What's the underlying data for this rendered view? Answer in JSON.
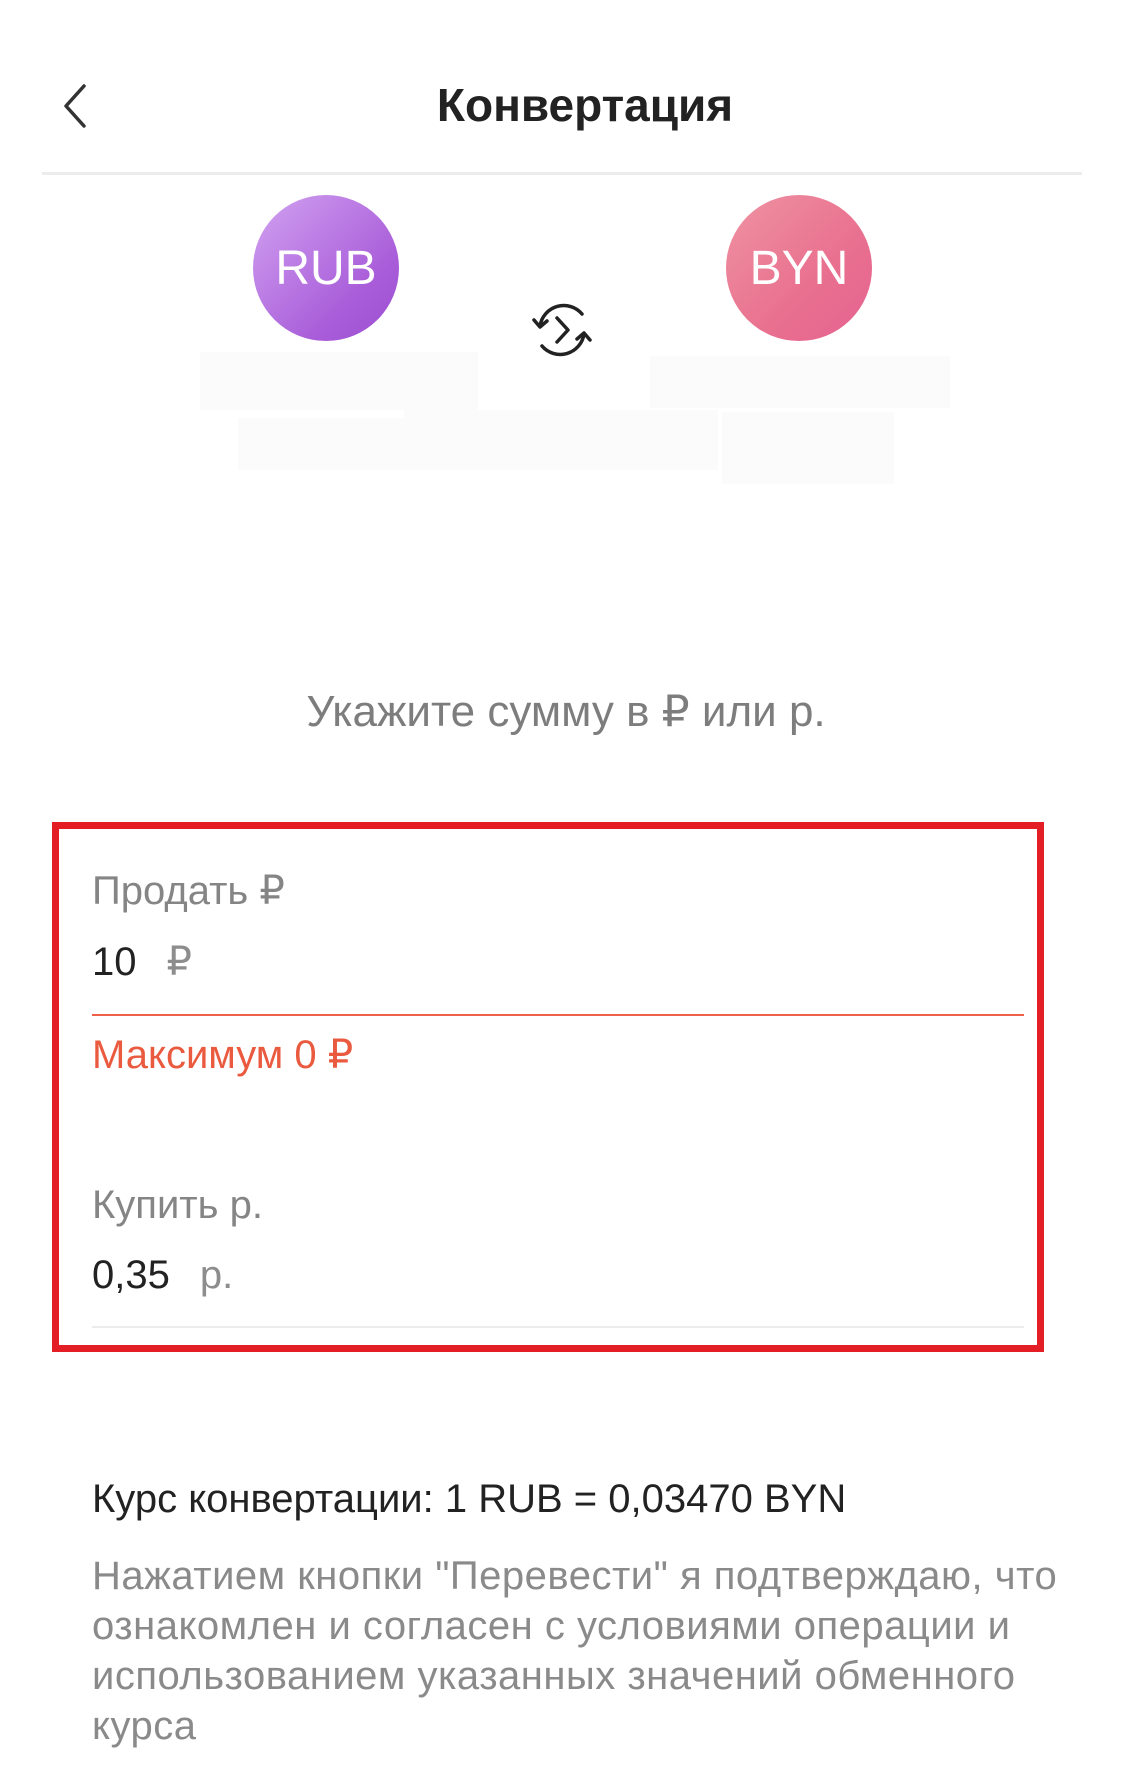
{
  "header": {
    "title": "Конвертация"
  },
  "currencies": {
    "from": "RUB",
    "to": "BYN"
  },
  "prompt": "Укажите сумму в ₽ или р.",
  "sell": {
    "label": "Продать ₽",
    "value": "10",
    "suffix": "₽",
    "error": "Максимум 0 ₽"
  },
  "buy": {
    "label": "Купить р.",
    "value": "0,35",
    "suffix": "р."
  },
  "rate": "Курс конвертации: 1 RUB = 0,03470 BYN",
  "disclaimer": "Нажатием кнопки \"Перевести\" я подтверждаю, что ознакомлен и согласен с условиями операции и использованием указанных значений обменного курса",
  "colors": {
    "highlight": "#e31e24",
    "error": "#ea5a3f",
    "rub_circle": "#a95dd9",
    "byn_circle": "#e9708f"
  },
  "icons": {
    "back": "chevron-left-icon",
    "swap": "swap-icon"
  }
}
